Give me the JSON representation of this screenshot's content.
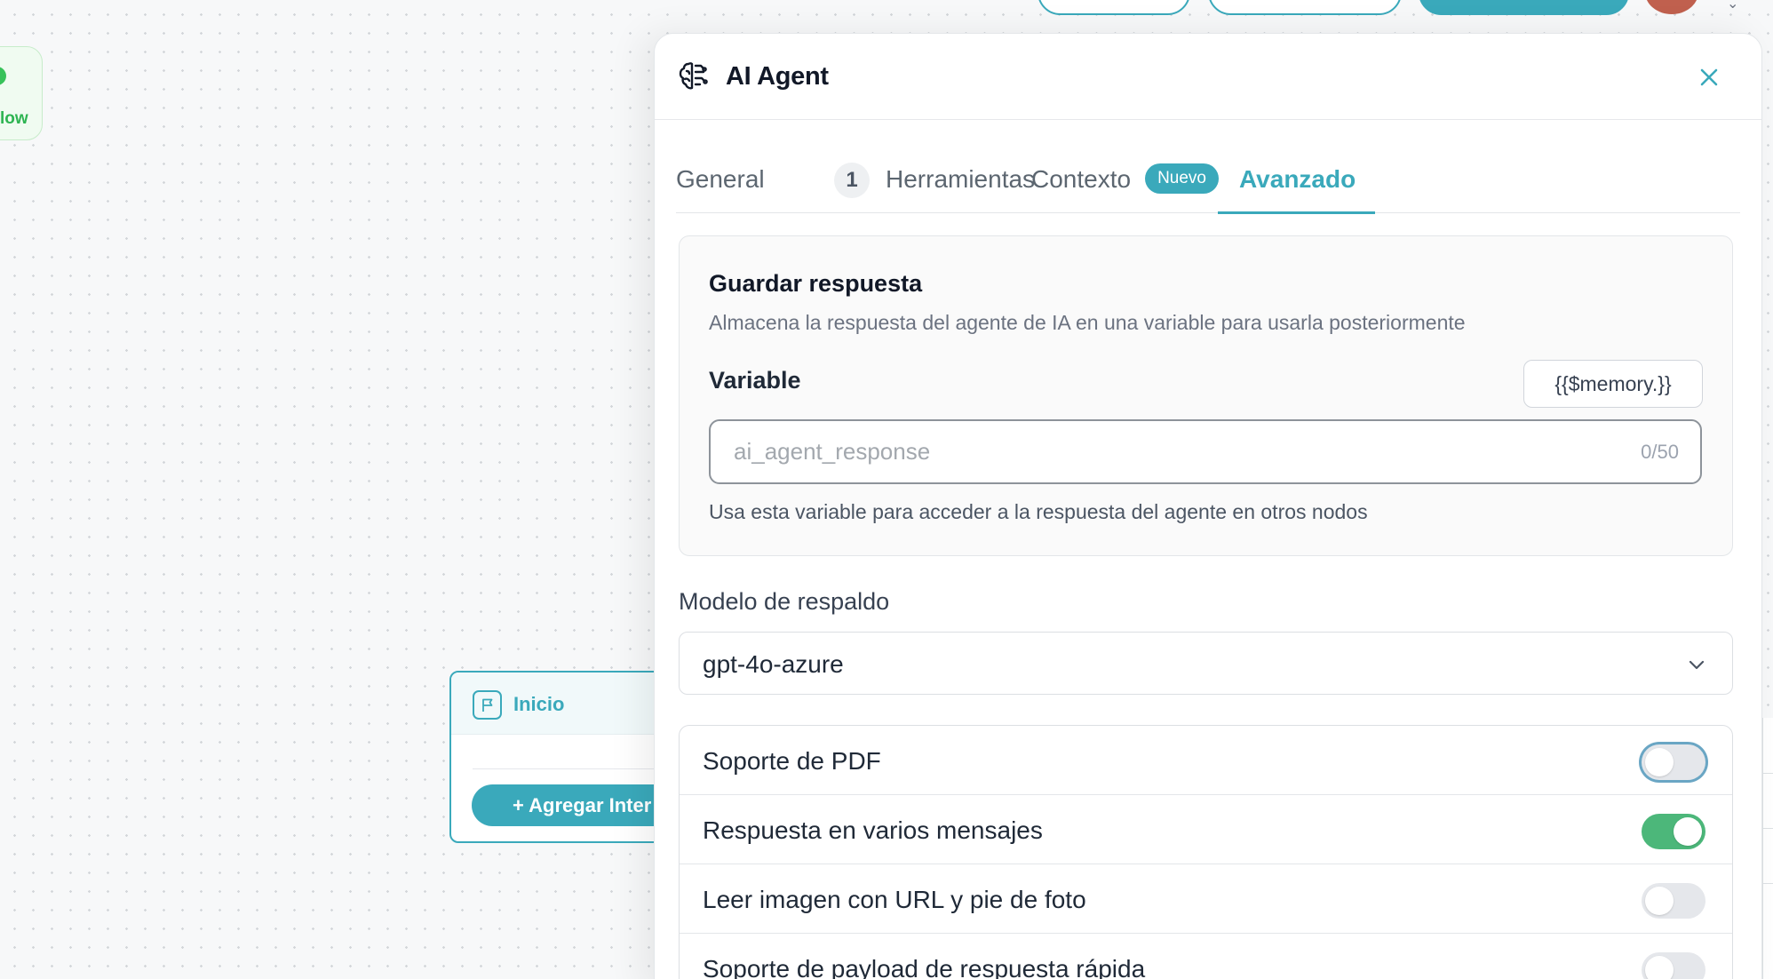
{
  "canvas": {
    "flow_node_label": "low",
    "inicio_node": {
      "title": "Inicio",
      "add_button": "+ Agregar Inter"
    }
  },
  "panel": {
    "title": "AI Agent",
    "tabs": [
      {
        "label": "General"
      },
      {
        "label": "Herramientas",
        "count": "1"
      },
      {
        "label": "Contexto",
        "badge": "Nuevo"
      },
      {
        "label": "Avanzado",
        "active": true
      }
    ],
    "save_response": {
      "title": "Guardar respuesta",
      "description": "Almacena la respuesta del agente de IA en una variable para usarla posteriormente",
      "variable_label": "Variable",
      "memory_button": "{{$memory.}}",
      "input_placeholder": "ai_agent_response",
      "input_value": "",
      "char_count": "0/50",
      "help_text": "Usa esta variable para acceder a la respuesta del agente en otros nodos"
    },
    "fallback_model": {
      "label": "Modelo de respaldo",
      "selected": "gpt-4o-azure"
    },
    "options": [
      {
        "label": "Soporte de PDF",
        "enabled": false
      },
      {
        "label": "Respuesta en varios mensajes",
        "enabled": true
      },
      {
        "label": "Leer imagen con URL y pie de foto",
        "enabled": false
      },
      {
        "label": "Soporte de payload de respuesta rápida",
        "enabled": false
      }
    ]
  },
  "colors": {
    "accent": "#3aa9bb",
    "toggle_on": "#4cb77a",
    "flow_green": "#2eb452"
  }
}
